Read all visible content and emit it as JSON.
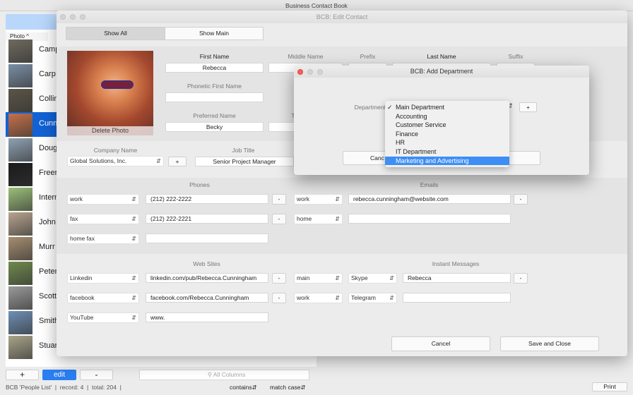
{
  "app": {
    "title": "Business Contact Book"
  },
  "list": {
    "column_header": "Photo",
    "sort_icon": "chevron-up-icon",
    "rows": [
      {
        "name": "Camp",
        "color": "#6e6a5e"
      },
      {
        "name": "Carp",
        "color": "#7b8fa6"
      },
      {
        "name": "Collin",
        "color": "#5b5547"
      },
      {
        "name": "Cunn",
        "color": "#c7704a",
        "selected": true
      },
      {
        "name": "Doug",
        "color": "#8fa2b3"
      },
      {
        "name": "Freer",
        "color": "#1b1b1b"
      },
      {
        "name": "Intern",
        "color": "#9cbf7a"
      },
      {
        "name": "John",
        "color": "#b8a48f"
      },
      {
        "name": "Murr",
        "color": "#a68e70"
      },
      {
        "name": "Peter",
        "color": "#6f8a4c"
      },
      {
        "name": "Scott",
        "color": "#9a9a9a"
      },
      {
        "name": "Smith",
        "color": "#6e8fb5"
      },
      {
        "name": "Stuar",
        "color": "#a9a48a"
      }
    ]
  },
  "bottom": {
    "add": "+",
    "edit": "edit",
    "remove": "-",
    "search_placeholder": "All Columns",
    "status": "BCB 'People List'  |  record: 4  |  total: 204  |",
    "contains": "contains",
    "match_case": "match case",
    "print": "Print"
  },
  "edit_window": {
    "title": "BCB: Edit Contact",
    "tab_show_all": "Show All",
    "tab_show_main": "Show Main",
    "delete_photo": "Delete Photo",
    "labels": {
      "first_name": "First Name",
      "middle_name": "Middle Name",
      "prefix": "Prefix",
      "last_name": "Last Name",
      "suffix": "Suffix",
      "phonetic_first": "Phonetic First Name",
      "preferred": "Preferred Name",
      "title_partial": "T",
      "company": "Company Name",
      "job_title": "Job Title",
      "phones": "Phones",
      "emails": "Emails",
      "web_sites": "Web Sites",
      "instant_messages": "Instant Messages"
    },
    "first_name": "Rebecca",
    "preferred_name": "Becky",
    "company": "Global Solutions, Inc.",
    "job_title": "Senior Project Manager",
    "plus": "+",
    "minus": "-",
    "phones": [
      {
        "type": "work",
        "value": "(212) 222-2222"
      },
      {
        "type": "fax",
        "value": "(212) 222-2221"
      },
      {
        "type": "home fax",
        "value": ""
      }
    ],
    "emails": [
      {
        "type": "work",
        "value": "rebecca.cunningham@website.com"
      },
      {
        "type": "home",
        "value": ""
      }
    ],
    "web_sites": [
      {
        "type": "Linkedin",
        "value": "linkedin.com/pub/Rebecca.Cunningham"
      },
      {
        "type": "facebook",
        "value": "facebook.com/Rebecca.Cunningham"
      },
      {
        "type": "YouTube",
        "value": "www."
      }
    ],
    "instant_messages": [
      {
        "type": "main",
        "service": "Skype",
        "value": "Rebecca"
      },
      {
        "type": "work",
        "service": "Telegram",
        "value": ""
      }
    ],
    "cancel": "Cancel",
    "save": "Save and Close"
  },
  "dept_dialog": {
    "title": "BCB: Add Department",
    "label": "Department",
    "plus": "+",
    "cancel_partial": "Canc",
    "options": [
      "Main Department",
      "Accounting",
      "Customer Service",
      "Finance",
      "HR",
      "IT Department",
      "Marketing and Advertising"
    ],
    "checked": "Main Department",
    "highlighted": "Marketing and Advertising"
  }
}
